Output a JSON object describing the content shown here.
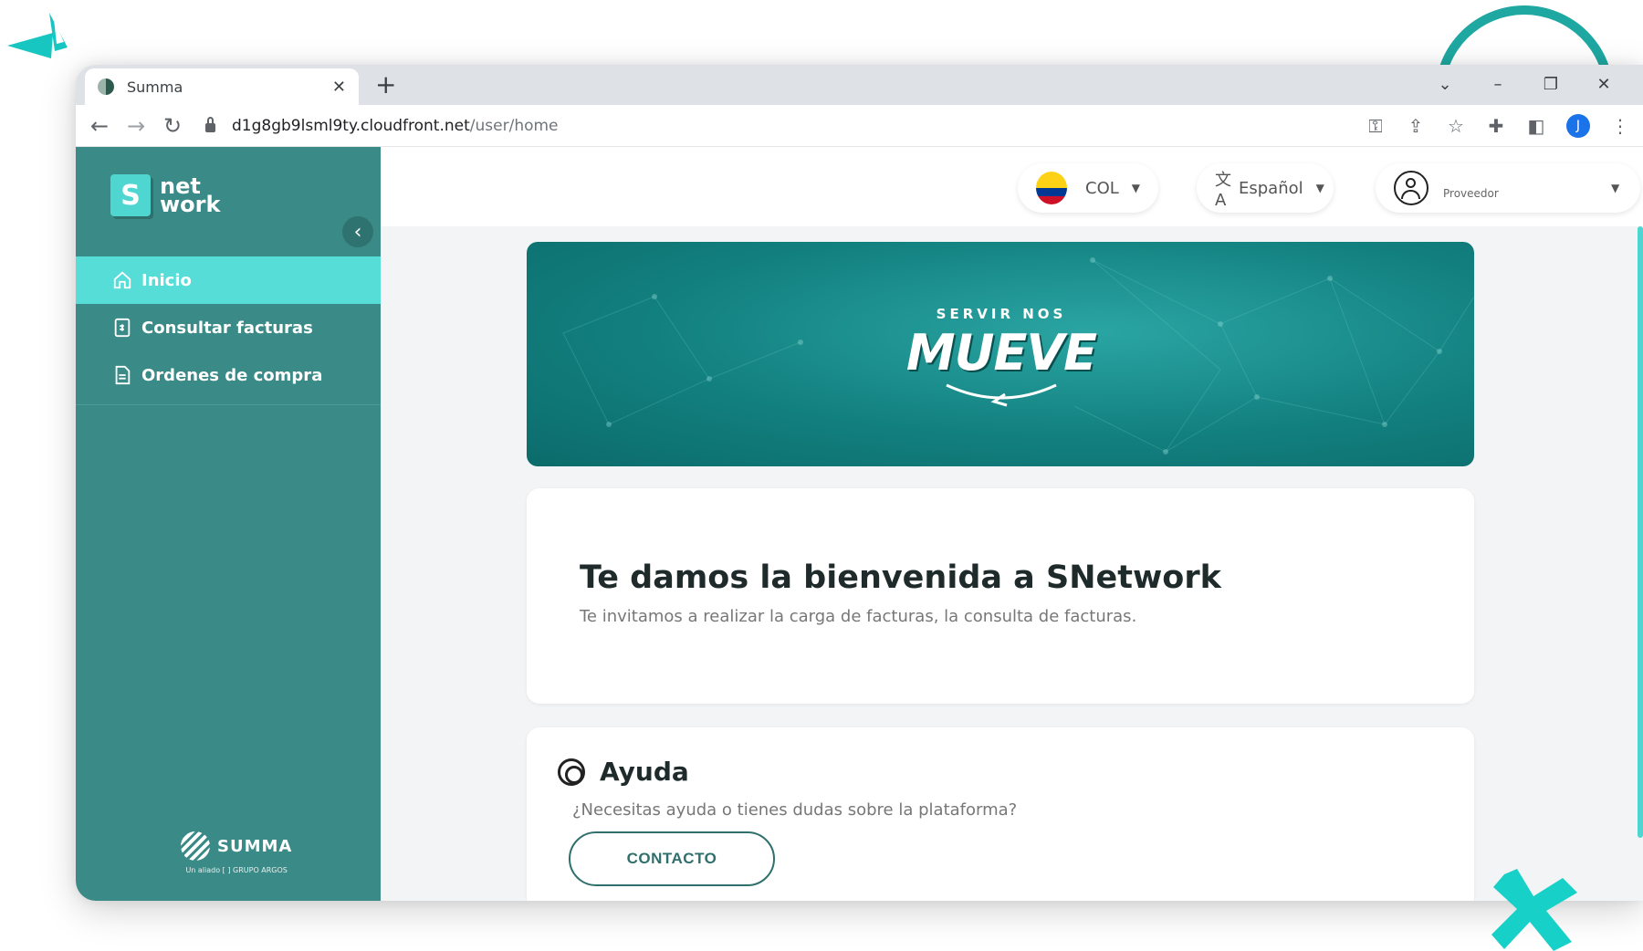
{
  "browser": {
    "tab_title": "Summa",
    "new_tab_glyph": "+",
    "url_host": "d1g8gb9lsml9ty.cloudfront.net",
    "url_path": "/user/home",
    "profile_initial": "J"
  },
  "sidebar": {
    "logo_letter": "S",
    "logo_line1": "net",
    "logo_line2": "work",
    "items": [
      {
        "label": "Inicio",
        "icon": "home-icon",
        "active": true
      },
      {
        "label": "Consultar facturas",
        "icon": "invoice-icon",
        "active": false
      },
      {
        "label": "Ordenes de compra",
        "icon": "document-icon",
        "active": false
      }
    ],
    "footer_brand": "SUMMA",
    "footer_sub": "Un aliado [ ] GRUPO ARGOS"
  },
  "topbar": {
    "country": "COL",
    "language": "Español",
    "role": "Proveedor"
  },
  "banner": {
    "arc_text": "SERVIR NOS",
    "main_text": "MUEVE"
  },
  "welcome": {
    "title": "Te damos la bienvenida a SNetwork",
    "subtitle": "Te invitamos a realizar la carga de facturas, la consulta de facturas."
  },
  "help": {
    "title": "Ayuda",
    "subtitle": "¿Necesitas ayuda o tienes dudas sobre la plataforma?",
    "button": "CONTACTO"
  },
  "colors": {
    "sidebar": "#3a8a87",
    "active_item": "#56ddd8",
    "banner": "#12807f",
    "accent": "#1fa7a1"
  }
}
